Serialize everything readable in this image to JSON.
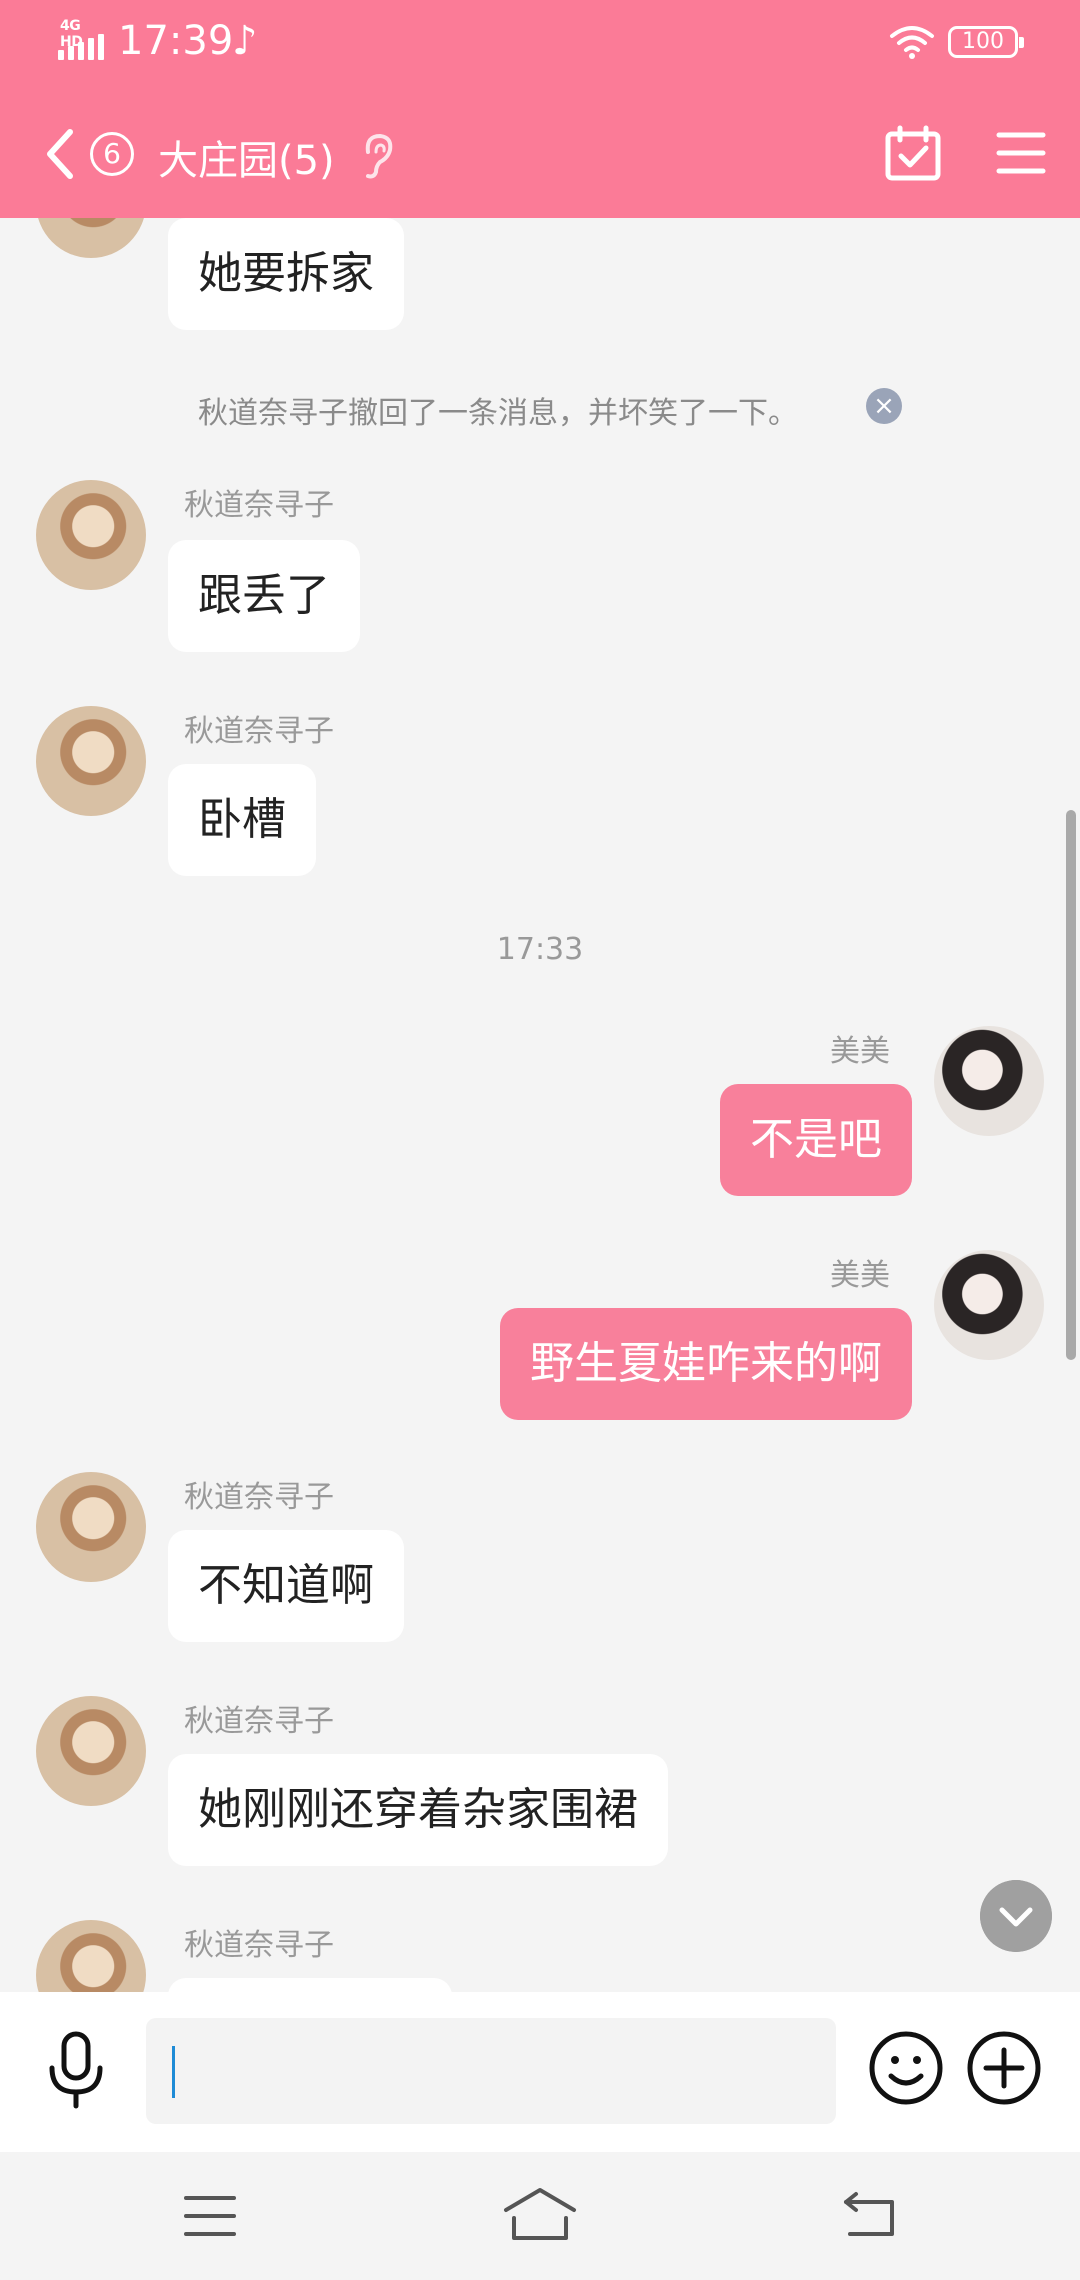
{
  "status_bar": {
    "network": "4G HD",
    "time": "17:39",
    "battery": "100"
  },
  "header": {
    "unread_count": "6",
    "title": "大庄园(5)"
  },
  "messages": [
    {
      "sender": "",
      "text": "她要拆家",
      "side": "left"
    },
    {
      "sender": "秋道奈寻子",
      "text": "跟丢了",
      "side": "left"
    },
    {
      "sender": "秋道奈寻子",
      "text": "卧槽",
      "side": "left"
    },
    {
      "sender": "美美",
      "text": "不是吧",
      "side": "right"
    },
    {
      "sender": "美美",
      "text": "野生夏娃咋来的啊",
      "side": "right"
    },
    {
      "sender": "秋道奈寻子",
      "text": "不知道啊",
      "side": "left"
    },
    {
      "sender": "秋道奈寻子",
      "text": "她刚刚还穿着杂家围裙",
      "side": "left"
    },
    {
      "sender": "秋道奈寻子",
      "text": "",
      "side": "left"
    }
  ],
  "system_notice": "秋道奈寻子撤回了一条消息，并坏笑了一下。",
  "timestamp": "17:33",
  "input": {
    "value": "",
    "placeholder": ""
  },
  "icons": {
    "signal": "signal-icon",
    "tiktok": "tiktok-icon",
    "wifi": "wifi-icon",
    "back": "chevron-left-icon",
    "ear": "ear-icon",
    "calendar": "calendar-check-icon",
    "menu": "menu-icon",
    "mic": "microphone-icon",
    "emoji": "emoji-icon",
    "plus": "plus-circle-icon",
    "scroll_down": "chevron-down-icon"
  },
  "colors": {
    "header": "#fb7b97",
    "outgoing_bubble": "#f8809b",
    "incoming_bubble": "#ffffff",
    "background": "#f4f4f4"
  }
}
